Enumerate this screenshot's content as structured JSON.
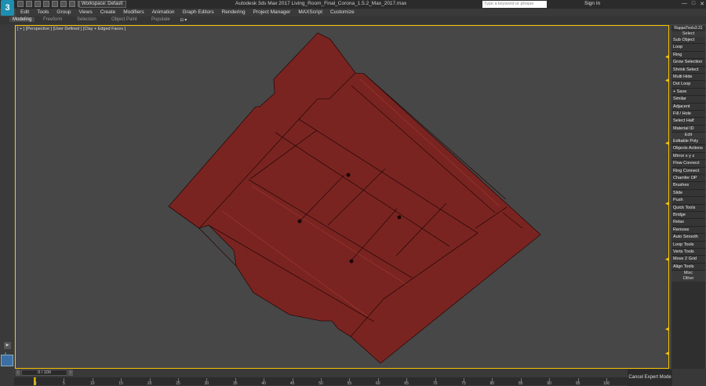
{
  "app": {
    "logo": "3",
    "title": "Autodesk 3ds Max 2017    Living_Room_Final_Corona_1.5.2_Max_2017.max",
    "workspace": "Workspace: Default",
    "search_placeholder": "Type a keyword or phrase",
    "signin": "Sign In",
    "window_buttons": [
      "—",
      "□",
      "✕"
    ]
  },
  "menu": [
    "Edit",
    "Tools",
    "Group",
    "Views",
    "Create",
    "Modifiers",
    "Animation",
    "Graph Editors",
    "Rendering",
    "Project Manager",
    "MAXScript",
    "Customize"
  ],
  "ribbon_tabs": [
    "Modeling",
    "Freeform",
    "Selection",
    "Object Paint",
    "Populate"
  ],
  "viewport": {
    "label": "[ + ] [Perspective ] [User Defined ] [Clay + Edged Faces ]",
    "object_color": "#7a2421",
    "border_color": "#f6c300"
  },
  "right_panel": {
    "title": "RappaTools3.31",
    "sections": [
      {
        "header": "Select",
        "items": [
          "Sub Object",
          "Loop",
          "Ring",
          "Grow Selection",
          "Shrink Select",
          "Multi Hide",
          "Dot Loop",
          "+ Save",
          "Similar",
          "Adjacent",
          "Fill / Hole",
          "Select Half",
          "Material ID"
        ]
      },
      {
        "header": "Edit",
        "items": [
          "Editable Poly",
          "Objects Actions",
          "Mirror  x  y  z",
          "Flow Connect",
          "Ring Connect",
          "Chamfer OP",
          "Brushes",
          "Slide",
          "Push",
          "Quick Tools",
          "Bridge",
          "Relax",
          "Remove",
          "Auto Smooth",
          "Loop Tools",
          "Verts Tools",
          "Move 2 Grid",
          "Align Tools"
        ]
      },
      {
        "header": "Misc",
        "items": []
      },
      {
        "header": "Other",
        "items": []
      }
    ]
  },
  "timeline": {
    "slider_text": "0 / 100",
    "ticks": [
      0,
      5,
      10,
      15,
      20,
      25,
      30,
      35,
      40,
      45,
      50,
      55,
      60,
      65,
      70,
      75,
      80,
      85,
      90,
      95,
      100
    ],
    "cancel_label": "Cancel Expert Mode"
  }
}
